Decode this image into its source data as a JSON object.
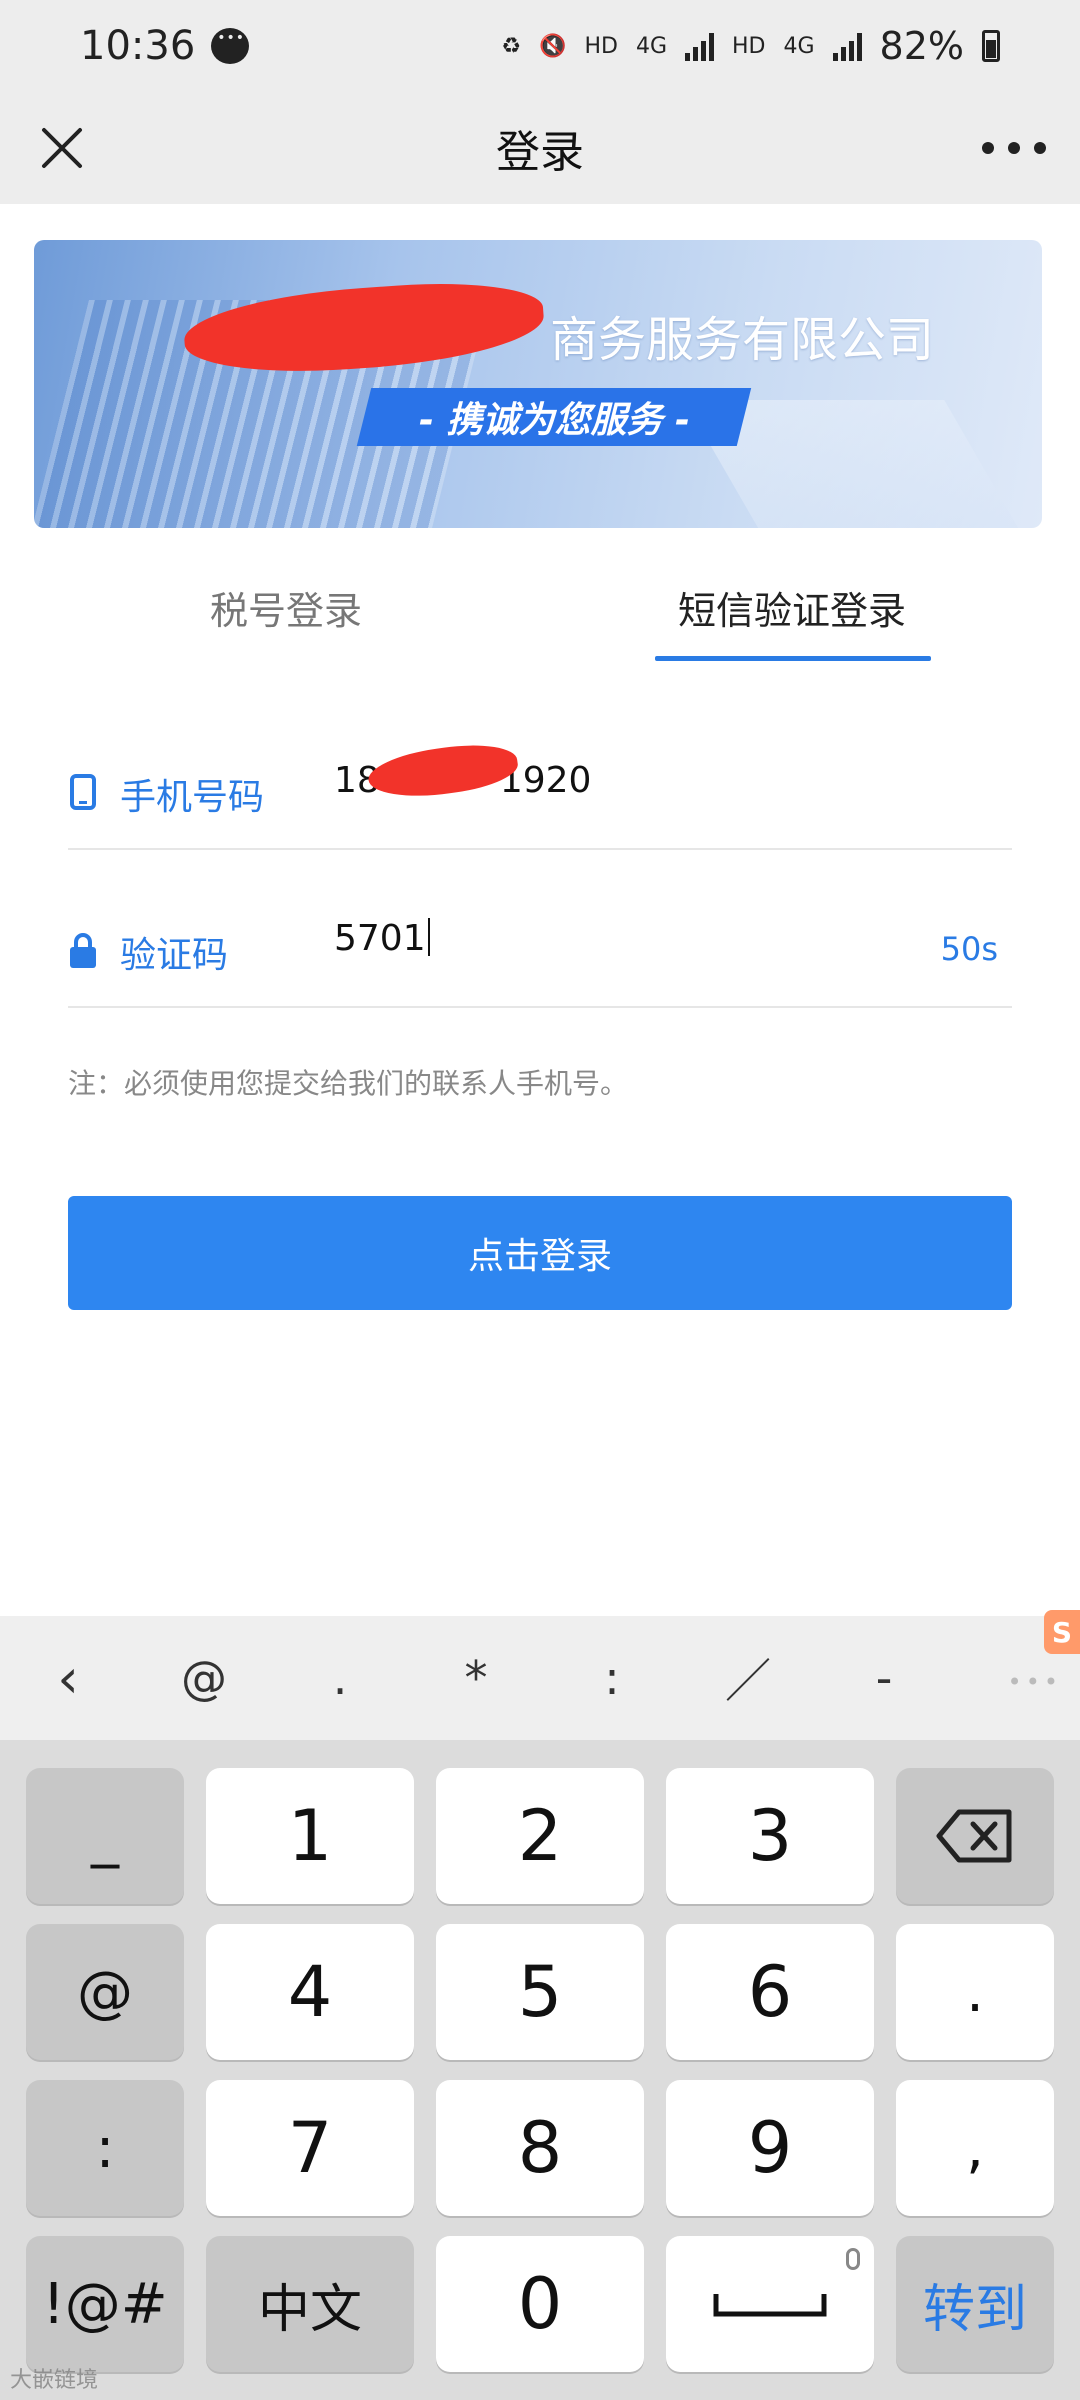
{
  "status": {
    "time": "10:36",
    "battery": "82%",
    "net1": "HD",
    "net2": "4G",
    "net3": "HD",
    "net4": "4G"
  },
  "nav": {
    "title": "登录"
  },
  "banner": {
    "company": "商务服务有限公司",
    "slogan": "- 携诚为您服务 -"
  },
  "tabs": [
    {
      "label": "税号登录",
      "active": false
    },
    {
      "label": "短信验证登录",
      "active": true
    }
  ],
  "form": {
    "phone_label": "手机号码",
    "phone_value_prefix": "18",
    "phone_value_suffix": "1920",
    "code_label": "验证码",
    "code_value": "5701",
    "timer": "50s",
    "note": "注：必须使用您提交给我们的联系人手机号。",
    "submit": "点击登录"
  },
  "keyboard": {
    "toolbar": [
      "@",
      ".",
      "*",
      ":",
      "／",
      "-"
    ],
    "left": [
      "_",
      "@",
      ":",
      "!@#"
    ],
    "rows": [
      [
        "1",
        "2",
        "3"
      ],
      [
        "4",
        "5",
        "6"
      ],
      [
        "7",
        "8",
        "9"
      ]
    ],
    "right": [
      ".",
      ","
    ],
    "zh": "中文",
    "zero": "0",
    "goto": "转到"
  },
  "watermark": "大嵌链境",
  "colors": {
    "accent": "#2a7be4",
    "button": "#2e86f0",
    "redaction": "#f2332a"
  }
}
